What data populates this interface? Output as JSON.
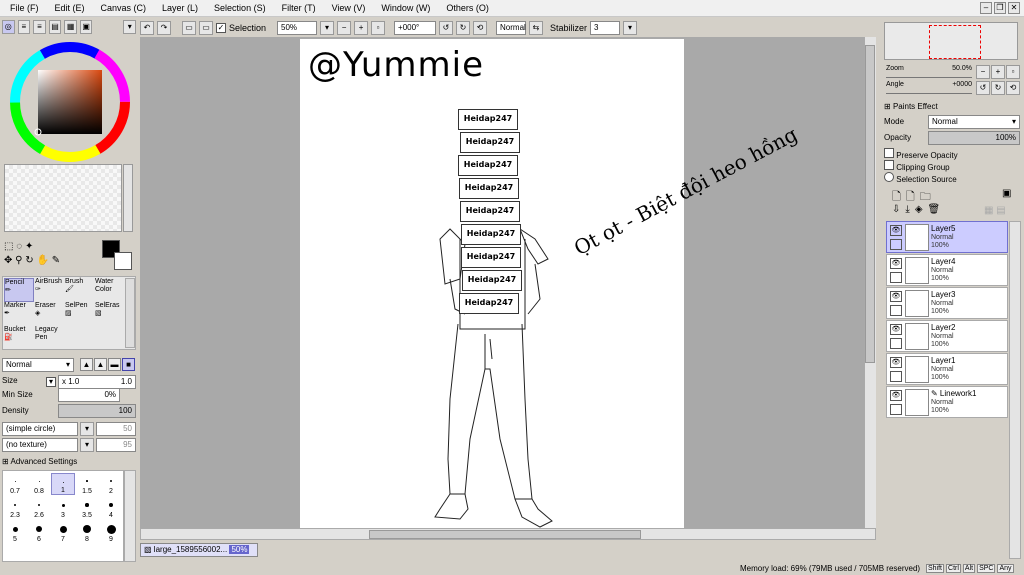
{
  "menu": [
    "File (F)",
    "Edit (E)",
    "Canvas (C)",
    "Layer (L)",
    "Selection (S)",
    "Filter (T)",
    "View (V)",
    "Window (W)",
    "Others (O)"
  ],
  "toolbar": {
    "selection_label": "Selection",
    "zoom_value": "50%",
    "rotation_value": "+000°",
    "blend_value": "Normal",
    "stabilizer_label": "Stabilizer",
    "stabilizer_value": "3"
  },
  "navigator": {
    "zoom_label": "Zoom",
    "zoom_value": "50.0%",
    "angle_label": "Angle",
    "angle_value": "+0000"
  },
  "layer_props": {
    "paints_effect": "Paints Effect",
    "mode_label": "Mode",
    "mode_value": "Normal",
    "opacity_label": "Opacity",
    "opacity_value": "100%",
    "preserve_opacity": "Preserve Opacity",
    "clipping_group": "Clipping Group",
    "selection_source": "Selection Source"
  },
  "layers": [
    {
      "name": "Layer5",
      "mode": "Normal",
      "opacity": "100%"
    },
    {
      "name": "Layer4",
      "mode": "Normal",
      "opacity": "100%"
    },
    {
      "name": "Layer3",
      "mode": "Normal",
      "opacity": "100%"
    },
    {
      "name": "Layer2",
      "mode": "Normal",
      "opacity": "100%"
    },
    {
      "name": "Layer1",
      "mode": "Normal",
      "opacity": "100%"
    },
    {
      "name": "Linework1",
      "mode": "Normal",
      "opacity": "100%"
    }
  ],
  "tools": [
    [
      "Pencil",
      "AirBrush",
      "Brush",
      "Water Color"
    ],
    [
      "Marker",
      "Eraser",
      "SelPen",
      "SelEras"
    ],
    [
      "Bucket",
      "Legacy Pen"
    ]
  ],
  "brush": {
    "blend": "Normal",
    "size_label": "Size",
    "size_mult": "x 1.0",
    "size_value": "1.0",
    "minsize_label": "Min Size",
    "minsize_value": "0%",
    "density_label": "Density",
    "density_value": "100",
    "shape": "(simple circle)",
    "shape_val": "50",
    "texture": "(no texture)",
    "texture_val": "95",
    "advanced": "Advanced Settings"
  },
  "size_presets": [
    "0.7",
    "0.8",
    "1",
    "1.5",
    "2",
    "2.3",
    "2.6",
    "3",
    "3.5",
    "4",
    "5",
    "6",
    "7",
    "8",
    "9"
  ],
  "canvas": {
    "watermark": "@Yummie",
    "vietnamese_text": "Ọt ọt - Biệt đội heo hồng",
    "box_text": "Heidap247"
  },
  "tab": {
    "file": "large_1589556002...",
    "zoom": "50%"
  },
  "status": {
    "memory": "Memory load: 69% (79MB used / 705MB reserved)",
    "keys": [
      "Shift",
      "Ctrl",
      "Alt",
      "SPC",
      "Any"
    ]
  }
}
